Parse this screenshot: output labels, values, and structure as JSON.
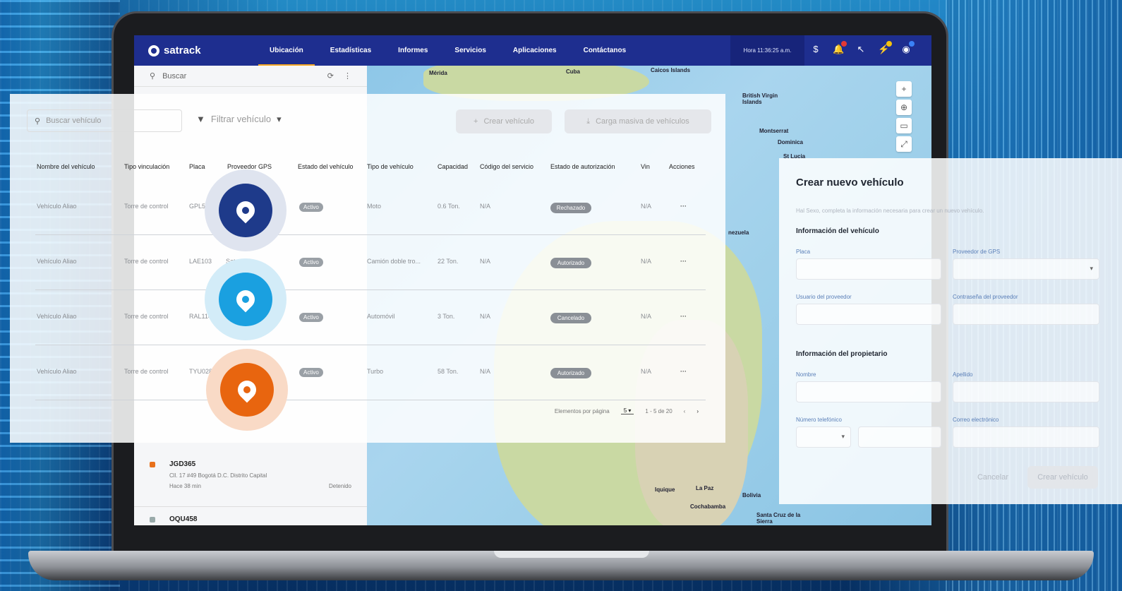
{
  "nav": {
    "brand": "satrack",
    "items": [
      "Ubicación",
      "Estadísticas",
      "Informes",
      "Servicios",
      "Aplicaciones",
      "Contáctanos"
    ],
    "active": "Ubicación",
    "time": "Hora 11:36:25 a.m.",
    "icons": [
      "dollar-icon",
      "bell-icon",
      "cursor-icon",
      "flash-icon",
      "user-icon"
    ],
    "colors": {
      "bar": "#1e2e8f",
      "accent": "#f4a623"
    }
  },
  "left_panel": {
    "search_placeholder": "Buscar",
    "items": [
      {
        "plate": "JGD365",
        "address": "Cll. 17 #49 Bogotá D.C. Distrito Capital",
        "meta": "Hace 38 min",
        "status": "Detenido"
      },
      {
        "plate": "OQU458"
      }
    ]
  },
  "map": {
    "labels": [
      "Mérida",
      "Cuba",
      "Caicos Islands",
      "British Virgin Islands",
      "Montserrat",
      "Dominica",
      "St Lucia",
      "nezuela",
      "Bolivia",
      "La Paz",
      "Cochabamba",
      "Santa Cruz de la Sierra",
      "Iquique"
    ],
    "controls": [
      "+",
      "⊕",
      "▭",
      "⤢"
    ]
  },
  "vehicles": {
    "search_placeholder": "Buscar vehículo",
    "filter_label": "Filtrar vehículo",
    "create_label": "Crear vehículo",
    "bulk_label": "Carga masiva de vehículos",
    "columns": [
      "Nombre del vehículo",
      "Tipo vinculación",
      "Placa",
      "Proveedor GPS",
      "Estado del vehículo",
      "Tipo de vehículo",
      "Capacidad",
      "Código del servicio",
      "Estado de autorización",
      "Vin",
      "Acciones"
    ],
    "rows": [
      {
        "name": "Vehículo Aliao",
        "link": "Torre de control",
        "plate": "GPL567",
        "provider": "",
        "status": "Activo",
        "type": "Moto",
        "capacity": "0.6 Ton.",
        "service": "N/A",
        "auth": "Rechazado",
        "vin": "N/A"
      },
      {
        "name": "Vehículo Aliao",
        "link": "Torre de control",
        "plate": "LAE103",
        "provider": "Satrack",
        "status": "Activo",
        "type": "Camión doble tro...",
        "capacity": "22 Ton.",
        "service": "N/A",
        "auth": "Autorizado",
        "vin": "N/A"
      },
      {
        "name": "Vehículo Aliao",
        "link": "Torre de control",
        "plate": "RAL114",
        "provider": "",
        "status": "Activo",
        "type": "Automóvil",
        "capacity": "3 Ton.",
        "service": "N/A",
        "auth": "Cancelado",
        "vin": "N/A"
      },
      {
        "name": "Vehículo Aliao",
        "link": "Torre de control",
        "plate": "TYU028",
        "provider": "",
        "status": "Activo",
        "type": "Turbo",
        "capacity": "58 Ton.",
        "service": "N/A",
        "auth": "Autorizado",
        "vin": "N/A"
      }
    ],
    "pager": {
      "per_page_label": "Elementos por página",
      "per_page": "5",
      "range": "1 - 5 de 20"
    }
  },
  "pins": [
    {
      "icon": "location-pin-icon",
      "core": "#1e3a8a",
      "halo": "#dfe4ef"
    },
    {
      "icon": "location-pin-icon",
      "core": "#1aa0e0",
      "halo": "#d3ecf8"
    },
    {
      "icon": "location-pin-icon",
      "core": "#e8650f",
      "halo": "#f9dac6"
    }
  ],
  "form": {
    "title": "Crear nuevo vehículo",
    "subtitle": "Hal Sexo, completa la información necesaria para crear un nuevo vehículo.",
    "section_vehicle": "Información del vehículo",
    "section_owner": "Información del propietario",
    "labels": {
      "plate": "Placa",
      "provider": "Proveedor de GPS",
      "provider_user": "Usuario del proveedor",
      "provider_password": "Contraseña del proveedor",
      "name": "Nombre",
      "lastname": "Apellido",
      "phone": "Número telefónico",
      "email": "Correo electrónico"
    },
    "cancel": "Cancelar",
    "submit": "Crear vehículo"
  }
}
